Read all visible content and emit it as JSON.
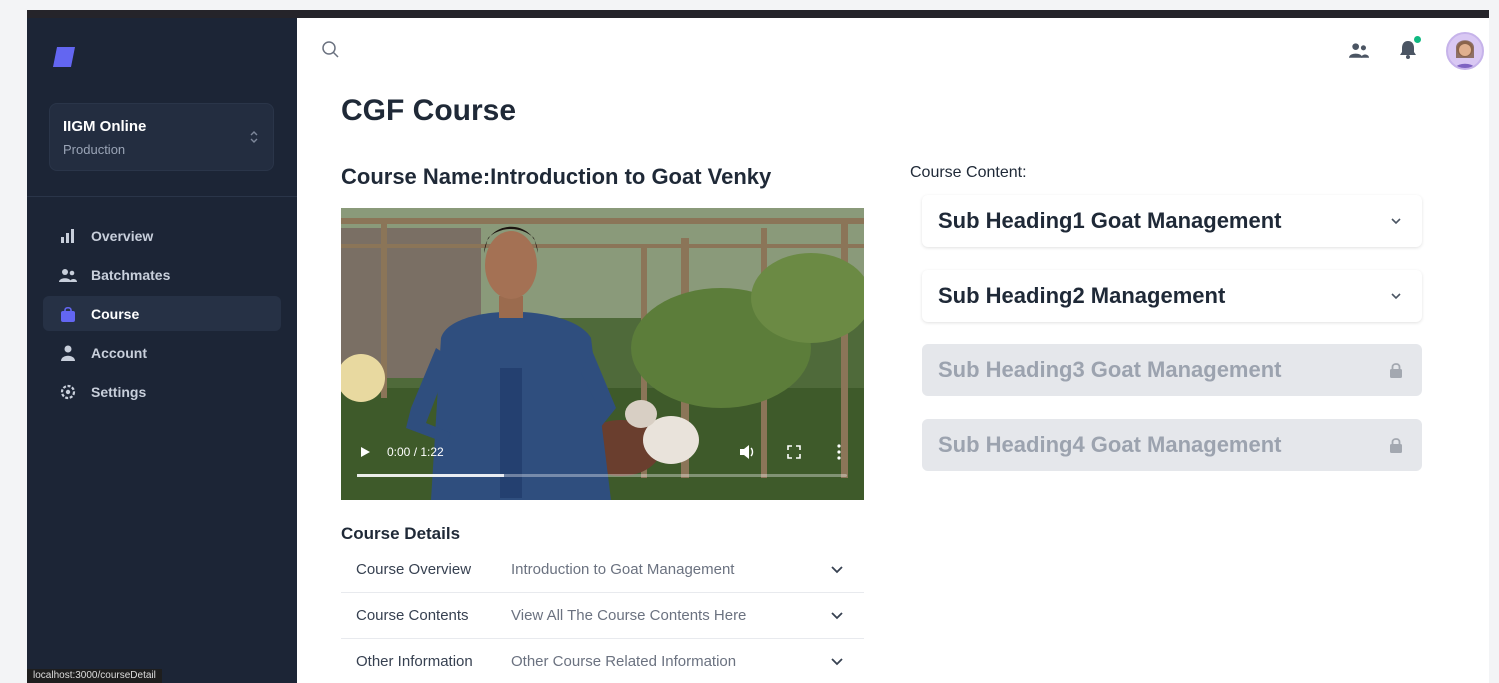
{
  "tenant": {
    "name": "IIGM Online",
    "environment": "Production"
  },
  "nav": [
    {
      "label": "Overview",
      "icon": "bar-chart-icon"
    },
    {
      "label": "Batchmates",
      "icon": "users-icon"
    },
    {
      "label": "Course",
      "icon": "shopping-bag-icon",
      "active": true
    },
    {
      "label": "Account",
      "icon": "user-icon"
    },
    {
      "label": "Settings",
      "icon": "gear-icon"
    }
  ],
  "status_url": "localhost:3000/courseDetail",
  "page": {
    "title": "CGF Course",
    "course_name": "Course Name:Introduction to Goat Venky"
  },
  "video": {
    "time": "0:00 / 1:22",
    "progress": 0.3
  },
  "details": {
    "title": "Course Details",
    "rows": [
      {
        "key": "Course Overview",
        "value": "Introduction to Goat Management"
      },
      {
        "key": "Course Contents",
        "value": "View All The Course Contents Here"
      },
      {
        "key": "Other Information",
        "value": "Other Course Related Information"
      }
    ]
  },
  "content": {
    "label": "Course Content:",
    "items": [
      {
        "title": "Sub Heading1 Goat Management",
        "locked": false
      },
      {
        "title": "Sub Heading2 Management",
        "locked": false
      },
      {
        "title": "Sub Heading3 Goat Management",
        "locked": true
      },
      {
        "title": "Sub Heading4 Goat Management",
        "locked": true
      }
    ]
  },
  "colors": {
    "sidebar": "#1c2536",
    "accent": "#6366f1",
    "online_dot": "#10b981"
  }
}
